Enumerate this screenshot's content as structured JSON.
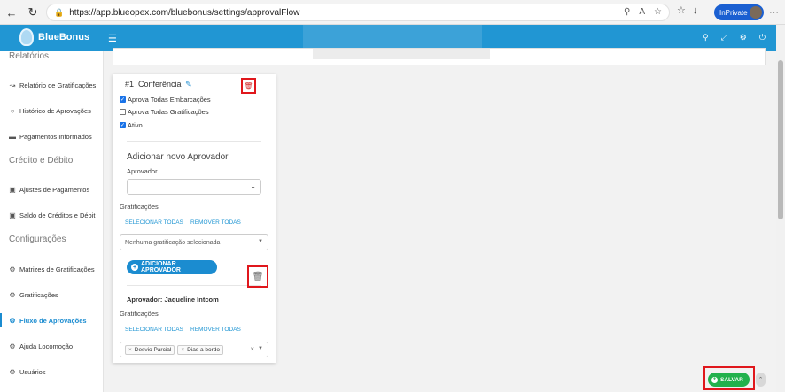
{
  "browser": {
    "url": "https://app.blueopex.com/bluebonus/settings/approvalFlow",
    "inprivate_label": "InPrivate",
    "read_aloud": "A"
  },
  "app": {
    "logo_text": "BlueBonus",
    "brand_color": "#2196d3"
  },
  "sidebar": {
    "sections": [
      {
        "title": "Relatórios"
      },
      {
        "title": "Crédito e Débito"
      },
      {
        "title": "Configurações"
      }
    ],
    "items": [
      {
        "label": "Relatório de Gratificações",
        "icon": "chart-icon"
      },
      {
        "label": "Histórico de Aprovações",
        "icon": "circle-icon"
      },
      {
        "label": "Pagamentos Informados",
        "icon": "card-icon"
      },
      {
        "label": "Ajustes de Pagamentos",
        "icon": "money-icon"
      },
      {
        "label": "Saldo de Créditos e Débit",
        "icon": "money-icon"
      },
      {
        "label": "Matrizes de Gratificações",
        "icon": "gears-icon"
      },
      {
        "label": "Gratificações",
        "icon": "gears-icon"
      },
      {
        "label": "Fluxo de Aprovações",
        "icon": "gears-icon"
      },
      {
        "label": "Ajuda Locomoção",
        "icon": "gears-icon"
      },
      {
        "label": "Usuários",
        "icon": "gears-icon"
      }
    ]
  },
  "flow": {
    "number": "#1",
    "name": "Conferência",
    "checkboxes": [
      {
        "label": "Aprova Todas Embarcações",
        "checked": true
      },
      {
        "label": "Aprova Todas Gratificações",
        "checked": false
      },
      {
        "label": "Ativo",
        "checked": true
      }
    ],
    "add_heading": "Adicionar novo Aprovador",
    "approver_label": "Aprovador",
    "gratificacoes_label": "Gratificações",
    "select_all": "SELECIONAR TODAS",
    "remove_all": "REMOVER TODAS",
    "multiselect_placeholder": "Nenhuma gratificação selecionada",
    "add_button": "ADICIONAR APROVADOR",
    "approver": {
      "title": "Aprovador: Jaqueline Intcom",
      "gratificacoes_label": "Gratificações",
      "select_all": "SELECIONAR TODAS",
      "remove_all": "REMOVER TODAS",
      "tags": [
        "Desvio Parcial",
        "Dias a bordo"
      ]
    }
  },
  "save_button": "SALVAR"
}
